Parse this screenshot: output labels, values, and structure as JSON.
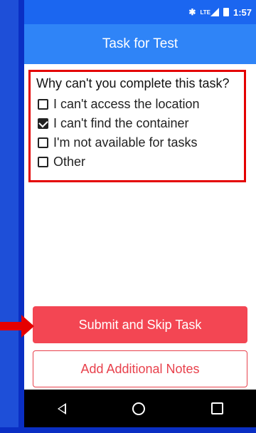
{
  "statusbar": {
    "time": "1:57",
    "network": "LTE"
  },
  "appbar": {
    "title": "Task for Test"
  },
  "form": {
    "question": "Why can't you complete this task?",
    "options": [
      {
        "label": "I can't access the location",
        "checked": false
      },
      {
        "label": "I can't find the container",
        "checked": true
      },
      {
        "label": "I'm not available for tasks",
        "checked": false
      },
      {
        "label": "Other",
        "checked": false
      }
    ]
  },
  "actions": {
    "primary_label": "Submit and Skip Task",
    "secondary_label": "Add Additional Notes"
  },
  "colors": {
    "statusbar": "#1b66f0",
    "appbar": "#2f84f7",
    "primary_button": "#f34653",
    "highlight_box": "#e40000",
    "frame": "#1e4fd8"
  },
  "icons": {
    "bluetooth": "bluetooth-icon",
    "signal": "cell-signal-icon",
    "battery": "battery-icon",
    "back": "nav-back-icon",
    "home": "nav-home-icon",
    "recent": "nav-recent-apps-icon",
    "annotation": "red-arrow-icon"
  }
}
